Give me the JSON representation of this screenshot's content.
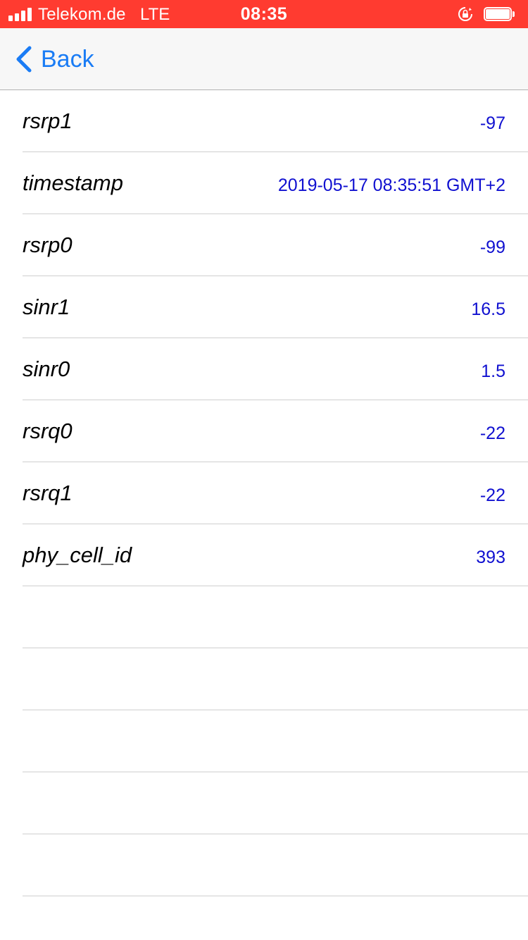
{
  "status_bar": {
    "carrier": "Telekom.de",
    "network": "LTE",
    "time": "08:35",
    "signal_bars": 4,
    "battery_level": 1.0
  },
  "nav": {
    "back_label": "Back"
  },
  "rows": [
    {
      "key": "rsrp1",
      "value": "-97"
    },
    {
      "key": "timestamp",
      "value": "2019-05-17 08:35:51 GMT+2"
    },
    {
      "key": "rsrp0",
      "value": "-99"
    },
    {
      "key": "sinr1",
      "value": "16.5"
    },
    {
      "key": "sinr0",
      "value": "1.5"
    },
    {
      "key": "rsrq0",
      "value": "-22"
    },
    {
      "key": "rsrq1",
      "value": "-22"
    },
    {
      "key": "phy_cell_id",
      "value": "393"
    },
    {
      "key": "",
      "value": ""
    },
    {
      "key": "",
      "value": ""
    },
    {
      "key": "",
      "value": ""
    },
    {
      "key": "",
      "value": ""
    },
    {
      "key": "",
      "value": ""
    }
  ],
  "colors": {
    "status_bar_bg": "#ff3b30",
    "accent": "#1a7cf5",
    "value_text": "#1010d0"
  }
}
